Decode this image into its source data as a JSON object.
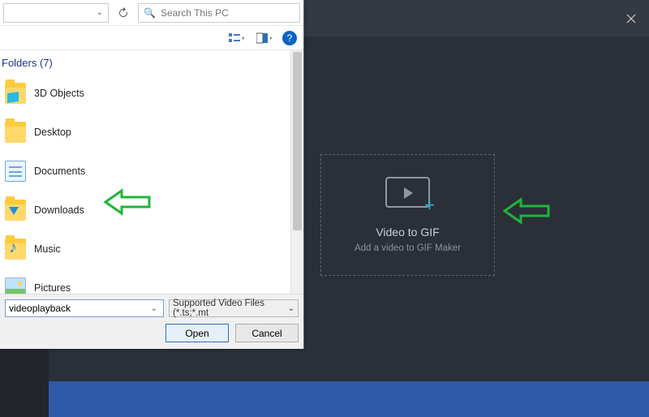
{
  "app": {
    "drop_title": "Video to GIF",
    "drop_sub": "Add a video to GIF Maker"
  },
  "dialog": {
    "search_placeholder": "Search This PC",
    "folders_header": "Folders (7)",
    "items": [
      {
        "label": "3D Objects"
      },
      {
        "label": "Desktop"
      },
      {
        "label": "Documents"
      },
      {
        "label": "Downloads"
      },
      {
        "label": "Music"
      },
      {
        "label": "Pictures"
      }
    ],
    "filename_value": "videoplayback",
    "filter_label": "Supported Video Files (*.ts;*.mt",
    "open_label": "Open",
    "cancel_label": "Cancel"
  }
}
